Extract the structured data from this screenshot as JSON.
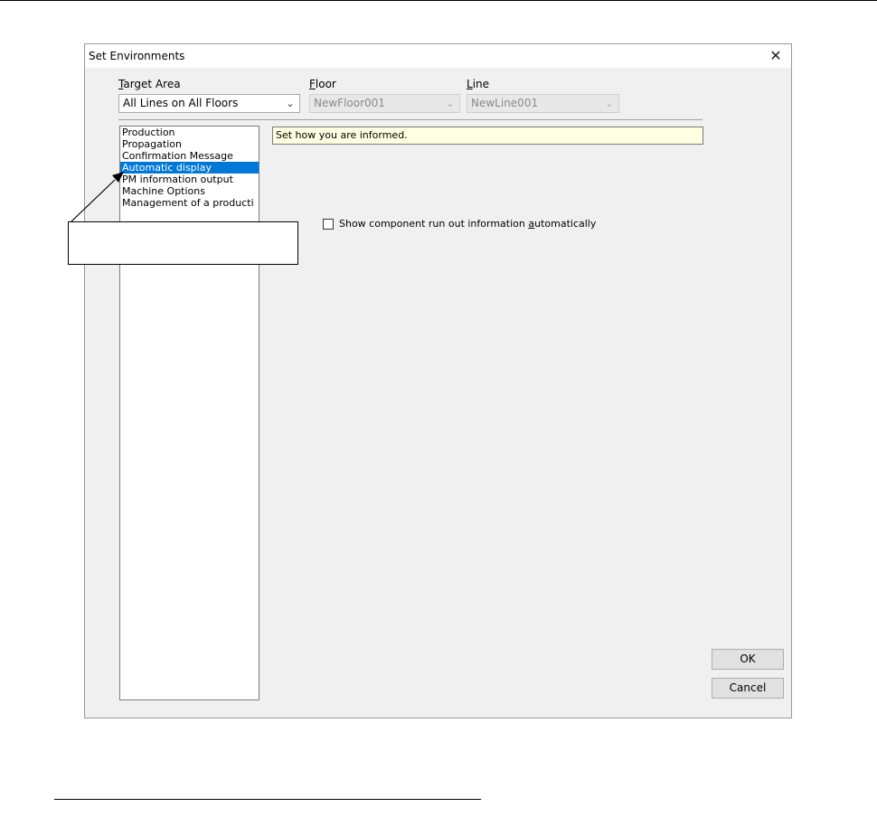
{
  "dialog": {
    "title": "Set Environments",
    "close_symbol": "✕"
  },
  "target_area": {
    "label_accel": "T",
    "label_rest": "arget Area",
    "value": "All Lines on All Floors"
  },
  "floor": {
    "label_accel": "F",
    "label_rest": "loor",
    "value": "NewFloor001"
  },
  "line": {
    "label_accel": "L",
    "label_rest": "ine",
    "value": "NewLine001"
  },
  "categories": [
    {
      "label": "Production",
      "selected": false
    },
    {
      "label": "Propagation",
      "selected": false
    },
    {
      "label": "Confirmation Message",
      "selected": false
    },
    {
      "label": "Automatic display",
      "selected": true
    },
    {
      "label": "PM information output",
      "selected": false
    },
    {
      "label": "Machine Options",
      "selected": false
    },
    {
      "label": "Management of a producti",
      "selected": false
    }
  ],
  "description": "Set how you are informed.",
  "show_component_checkbox": {
    "label_before": "Show component run out information ",
    "label_accel": "a",
    "label_after": "utomatically",
    "checked": false
  },
  "buttons": {
    "ok": "OK",
    "cancel": "Cancel"
  },
  "colors": {
    "selection": "#0078d7",
    "dialog_bg": "#f0f0f0",
    "description_bg": "#ffffe1"
  }
}
